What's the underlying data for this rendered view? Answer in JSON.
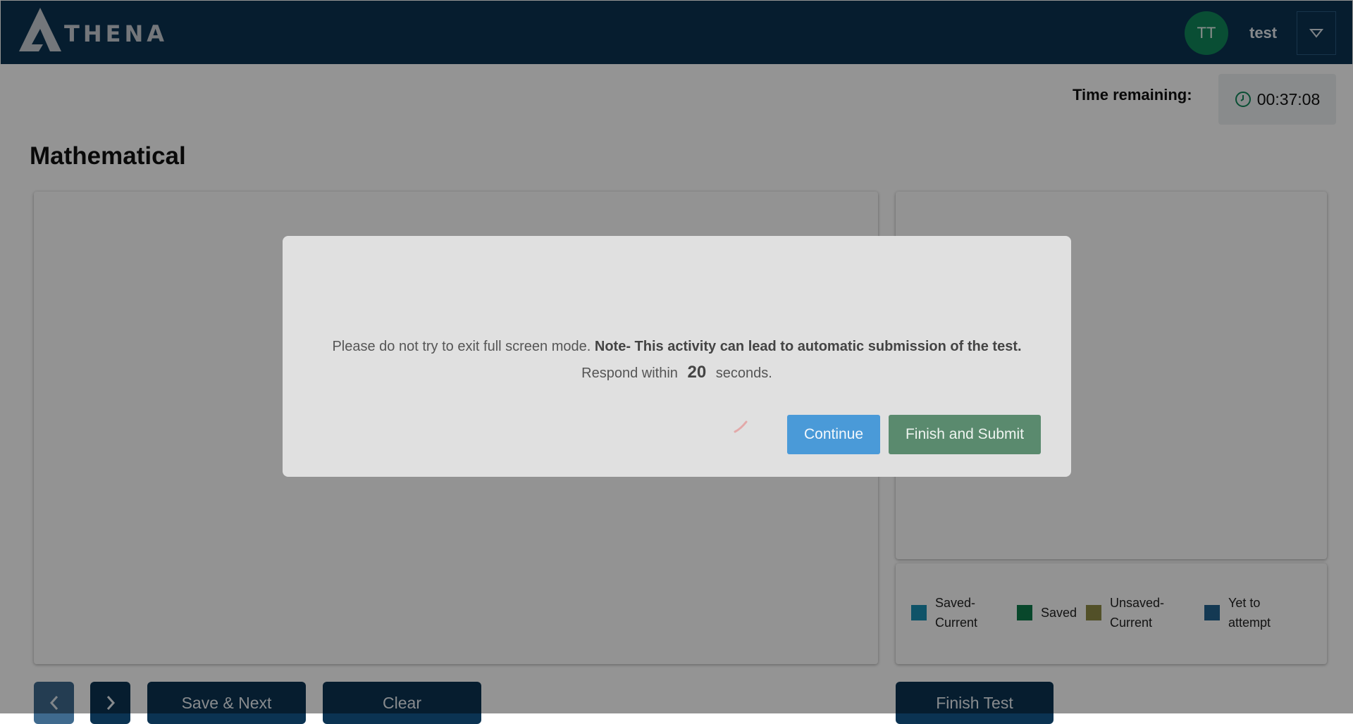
{
  "header": {
    "logo_text": "THENA",
    "avatar_initials": "TT",
    "username": "test",
    "menu_icon": "triangle-down-icon"
  },
  "timer": {
    "label": "Time remaining:",
    "value": "00:37:08",
    "icon": "clock-icon"
  },
  "section": {
    "title": "Mathematical"
  },
  "legend": {
    "items": [
      {
        "label": "Saved-\nCurrent",
        "color": "#1b8fb4"
      },
      {
        "label": "Saved",
        "color": "#0f7a4a"
      },
      {
        "label": "Unsaved-\nCurrent",
        "color": "#8d8a45"
      },
      {
        "label": "Yet to\nattempt",
        "color": "#24628f"
      }
    ]
  },
  "footer": {
    "prev_icon": "chevron-left-icon",
    "next_icon": "chevron-right-icon",
    "save_next_label": "Save & Next",
    "clear_label": "Clear",
    "finish_test_label": "Finish Test"
  },
  "modal": {
    "message_plain": "Please do not try to exit full screen mode.",
    "message_bold": "Note- This activity can lead to automatic submission of the test.",
    "respond_prefix": "Respond within",
    "countdown": "20",
    "respond_suffix": "seconds.",
    "continue_label": "Continue",
    "finish_submit_label": "Finish and Submit"
  }
}
